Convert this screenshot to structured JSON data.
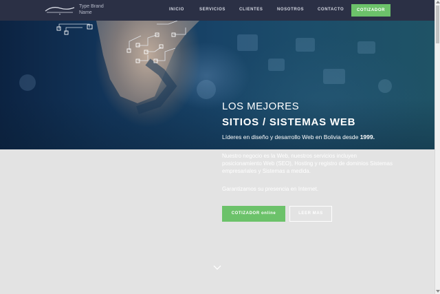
{
  "header": {
    "brand_line1": "Type Brand",
    "brand_line2": "Name",
    "logo_icon": "company-logo",
    "nav": [
      {
        "label": "INICIO"
      },
      {
        "label": "SERVICIOS"
      },
      {
        "label": "CLIENTES"
      },
      {
        "label": "NOSOTROS"
      },
      {
        "label": "CONTACTO"
      }
    ],
    "cta_label": "COTIZADOR"
  },
  "hero": {
    "title_line1": "LOS MEJORES",
    "title_line2": "SITIOS / SISTEMAS WEB",
    "lead_text": "Líderes en diseño y desarrollo Web en Bolivia desde",
    "lead_year": "1999.",
    "description": "Nuestro negocio es la Web, nuestros servicios incluyen posicionamiento Web (SEO), Hosting y registro de dominios Sistemas empresariales y Sistemas a medida.",
    "description2": "Garantizamos su presencia en Internet.",
    "primary_button": "COTIZADOR online",
    "secondary_button": "LEER MAS",
    "scroll_icon": "chevron-down-icon"
  },
  "colors": {
    "navbar_bg": "#2b3045",
    "accent_green": "#6cc26a",
    "page_bg": "#e3e3e3"
  }
}
